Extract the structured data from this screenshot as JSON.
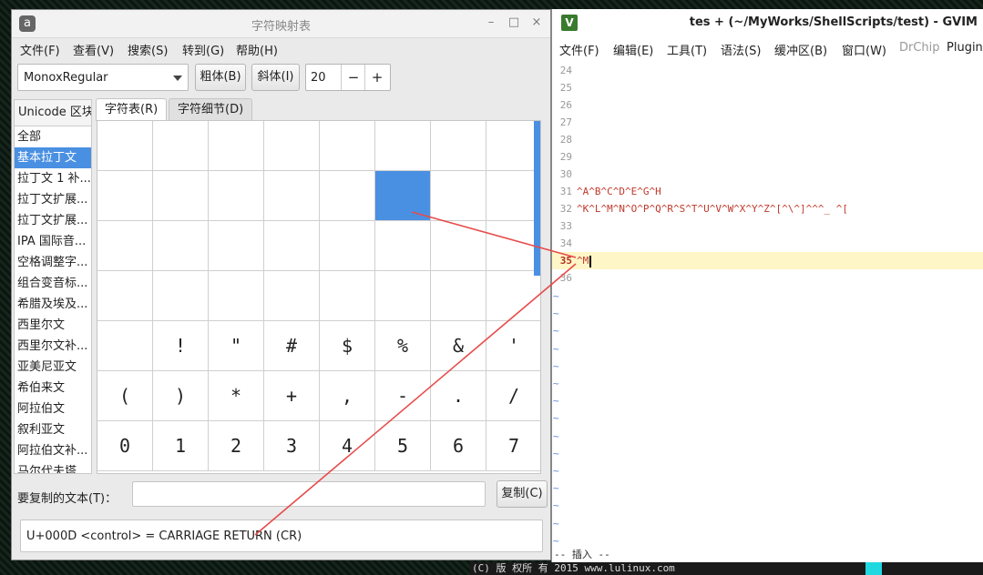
{
  "colors": {
    "accent": "#4a90e2",
    "annotation_line": "#e84a4a",
    "vim_text": "#c0392b",
    "vim_tilde": "#5a8ad8"
  },
  "charmap": {
    "app_icon": "a",
    "title": "字符映射表",
    "window_controls": {
      "minimize": "–",
      "maximize": "□",
      "close": "×"
    },
    "menu": [
      "文件(F)",
      "查看(V)",
      "搜索(S)",
      "转到(G)",
      "帮助(H)"
    ],
    "font_combo": "MonoxRegular",
    "bold_label": "粗体(B)",
    "italic_label": "斜体(I)",
    "font_size": "20",
    "minus": "−",
    "plus": "+",
    "blocks_header": "Unicode 区块",
    "blocks": [
      "全部",
      "基本拉丁文",
      "拉丁文 1 补...",
      "拉丁文扩展...",
      "拉丁文扩展...",
      "IPA 国际音...",
      "空格调整字...",
      "组合变音标...",
      "希腊及埃及...",
      "西里尔文",
      "西里尔文补...",
      "亚美尼亚文",
      "希伯来文",
      "阿拉伯文",
      "叙利亚文",
      "阿拉伯文补...",
      "马尔代夫塔..."
    ],
    "tabs": [
      "字符表(R)",
      "字符细节(D)"
    ],
    "grid": [
      "",
      "",
      "",
      "",
      "",
      "",
      "",
      "",
      "",
      "",
      "",
      "",
      "",
      "",
      "",
      "",
      "",
      "",
      "",
      "",
      "",
      "",
      "",
      "",
      "",
      "",
      "",
      "",
      "",
      "",
      "",
      "",
      " ",
      "!",
      "\"",
      "#",
      "$",
      "%",
      "&",
      "'",
      "(",
      ")",
      "*",
      "+",
      ",",
      "-",
      ".",
      "/",
      "0",
      "1",
      "2",
      "3",
      "4",
      "5",
      "6",
      "7"
    ],
    "copy_label": "要复制的文本(T)：",
    "copy_value": "",
    "copy_button": "复制(C)",
    "status": "U+000D <control>  = CARRIAGE RETURN (CR)"
  },
  "gvim": {
    "icon": "V",
    "title": "tes + (~/MyWorks/ShellScripts/test) - GVIM",
    "menu": [
      "文件(F)",
      "编辑(E)",
      "工具(T)",
      "语法(S)",
      "缓冲区(B)",
      "窗口(W)",
      "DrChip",
      "Plugin"
    ],
    "lines": [
      {
        "num": "24",
        "text": ""
      },
      {
        "num": "25",
        "text": ""
      },
      {
        "num": "26",
        "text": ""
      },
      {
        "num": "27",
        "text": ""
      },
      {
        "num": "28",
        "text": ""
      },
      {
        "num": "29",
        "text": ""
      },
      {
        "num": "30",
        "text": ""
      },
      {
        "num": "31",
        "text": "^A^B^C^D^E^G^H"
      },
      {
        "num": "32",
        "text": "^K^L^M^N^O^P^Q^R^S^T^U^V^W^X^Y^Z^[^\\^]^^^_ ^["
      },
      {
        "num": "33",
        "text": ""
      },
      {
        "num": "34",
        "text": ""
      },
      {
        "num": "35",
        "text": "^M"
      },
      {
        "num": "36",
        "text": ""
      }
    ],
    "tilde": "~",
    "mode": "-- 插入 --"
  },
  "taskbar": {
    "text": "(C) 版 权所 有 2015 www.lulinux.com"
  }
}
